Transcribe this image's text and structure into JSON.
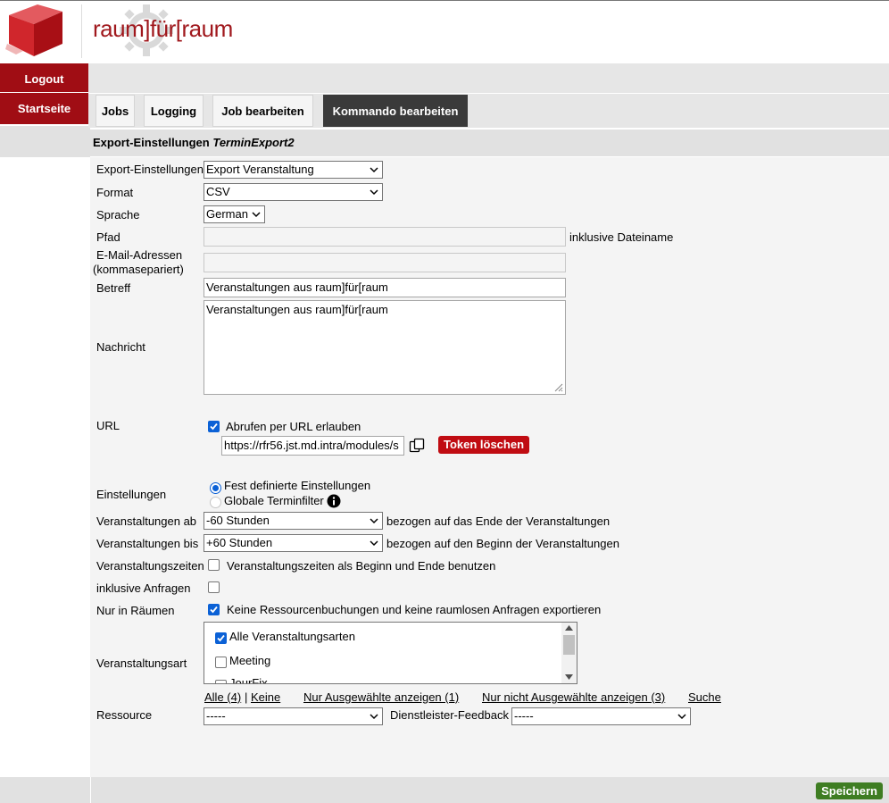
{
  "brand": {
    "logo_text": "raum]für[raum"
  },
  "nav": {
    "logout": "Logout",
    "home": "Startseite"
  },
  "tabs": [
    {
      "label": "Jobs"
    },
    {
      "label": "Logging"
    },
    {
      "label": "Job bearbeiten"
    },
    {
      "label": "Kommando bearbeiten"
    }
  ],
  "section": {
    "title": "Export-Einstellungen",
    "name": "TerminExport2"
  },
  "form": {
    "export_settings": {
      "label": "Export-Einstellungen",
      "value": "Export Veranstaltung"
    },
    "format": {
      "label": "Format",
      "value": "CSV"
    },
    "language": {
      "label": "Sprache",
      "value": "German"
    },
    "path": {
      "label": "Pfad",
      "value": "",
      "hint": "inklusive Dateiname"
    },
    "email": {
      "label_line1": "E-Mail-Adressen",
      "label_line2": "(kommasepariert)",
      "value": ""
    },
    "subject": {
      "label": "Betreff",
      "value": "Veranstaltungen aus raum]für[raum"
    },
    "message": {
      "label": "Nachricht",
      "value": "Veranstaltungen aus raum]für[raum"
    },
    "url": {
      "label": "URL",
      "checkbox_label": "Abrufen per URL erlauben",
      "checked": true,
      "value": "https://rfr56.jst.md.intra/modules/s",
      "token_button": "Token löschen"
    },
    "settings": {
      "label": "Einstellungen",
      "option_fixed": "Fest definierte Einstellungen",
      "option_global": "Globale Terminfilter"
    },
    "from": {
      "label": "Veranstaltungen ab",
      "value": "-60 Stunden",
      "suffix": "bezogen auf das Ende der Veranstaltungen"
    },
    "to": {
      "label": "Veranstaltungen bis",
      "value": "+60 Stunden",
      "suffix": "bezogen auf den Beginn der Veranstaltungen"
    },
    "times": {
      "label": "Veranstaltungszeiten",
      "checkbox_label": "Veranstaltungszeiten als Beginn und Ende benutzen",
      "checked": false
    },
    "requests": {
      "label": "inklusive Anfragen",
      "checked": false
    },
    "rooms_only": {
      "label": "Nur in Räumen",
      "checkbox_label": "Keine Ressourcenbuchungen und keine raumlosen Anfragen exportieren",
      "checked": true
    },
    "event_type": {
      "label": "Veranstaltungsart",
      "items": [
        {
          "label": "Alle Veranstaltungsarten",
          "checked": true
        },
        {
          "label": "Meeting",
          "checked": false
        },
        {
          "label": "JourFix",
          "checked": false
        }
      ],
      "links": {
        "all": "Alle (4)",
        "sep": "|",
        "none": "Keine",
        "show_selected": "Nur Ausgewählte anzeigen (1)",
        "show_unselected": "Nur nicht Ausgewählte anzeigen (3)",
        "search": "Suche"
      }
    },
    "resource": {
      "label": "Ressource",
      "value": "-----"
    },
    "provider_feedback": {
      "label": "Dienstleister-Feedback",
      "value": "-----"
    }
  },
  "footer": {
    "save": "Speichern"
  },
  "colors": {
    "brand_red": "#a00d14",
    "token_red": "#c00c12",
    "save_green": "#3e7d22",
    "check_blue": "#0b61d6"
  }
}
